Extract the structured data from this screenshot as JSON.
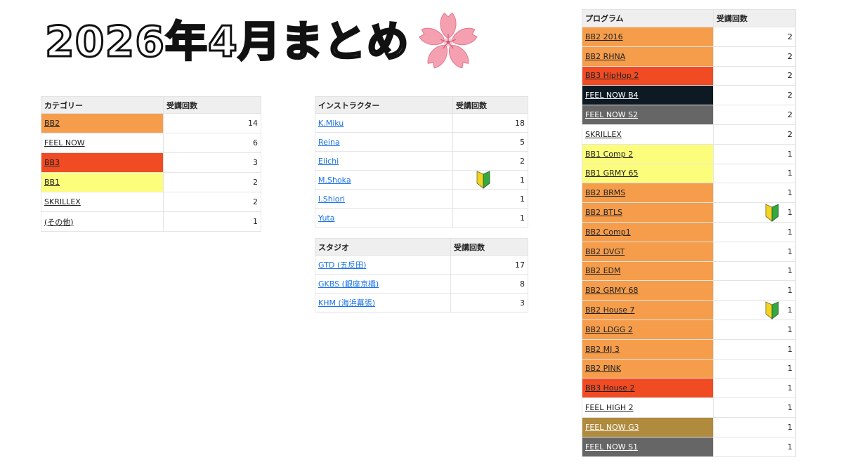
{
  "title": "2026年4月まとめ",
  "colors": {
    "orange": "#f59d4b",
    "red": "#f04b22",
    "yellow": "#fdfd7c",
    "black": "#0d1a23",
    "gray": "#666666",
    "gold": "#b08a3d",
    "white": "#ffffff"
  },
  "category_table": {
    "headers": [
      "カテゴリー",
      "受講回数"
    ],
    "rows": [
      {
        "name": "BB2",
        "count": "14",
        "bg": "orange"
      },
      {
        "name": "FEEL NOW",
        "count": "6",
        "bg": "white"
      },
      {
        "name": "BB3",
        "count": "3",
        "bg": "red"
      },
      {
        "name": "BB1",
        "count": "2",
        "bg": "yellow"
      },
      {
        "name": "SKRILLEX",
        "count": "2",
        "bg": "white"
      },
      {
        "name": "(その他)",
        "count": "1",
        "bg": "white"
      }
    ]
  },
  "instructor_table": {
    "headers": [
      "インストラクター",
      "受講回数"
    ],
    "rows": [
      {
        "name": "K.Miku",
        "count": "18"
      },
      {
        "name": "Reina",
        "count": "5"
      },
      {
        "name": "Eiichi",
        "count": "2"
      },
      {
        "name": "M.Shoka",
        "count": "1",
        "beginner": true
      },
      {
        "name": "I.Shiori",
        "count": "1"
      },
      {
        "name": "Yuta",
        "count": "1"
      }
    ]
  },
  "studio_table": {
    "headers": [
      "スタジオ",
      "受講回数"
    ],
    "rows": [
      {
        "name": "GTD (五反田)",
        "count": "17"
      },
      {
        "name": "GKBS (銀座京橋)",
        "count": "8"
      },
      {
        "name": "KHM (海浜幕張)",
        "count": "3"
      }
    ]
  },
  "program_table": {
    "headers": [
      "プログラム",
      "受講回数"
    ],
    "rows": [
      {
        "name": "BB2 2016",
        "count": "2",
        "bg": "orange"
      },
      {
        "name": "BB2 RHNA",
        "count": "2",
        "bg": "orange"
      },
      {
        "name": "BB3 HipHop 2",
        "count": "2",
        "bg": "red"
      },
      {
        "name": "FEEL NOW B4",
        "count": "2",
        "bg": "black"
      },
      {
        "name": "FEEL NOW S2",
        "count": "2",
        "bg": "gray"
      },
      {
        "name": "SKRILLEX",
        "count": "2",
        "bg": "white"
      },
      {
        "name": "BB1 Comp 2",
        "count": "1",
        "bg": "yellow"
      },
      {
        "name": "BB1 GRMY 65",
        "count": "1",
        "bg": "yellow"
      },
      {
        "name": "BB2 BRMS",
        "count": "1",
        "bg": "orange"
      },
      {
        "name": "BB2 BTLS",
        "count": "1",
        "bg": "orange",
        "beginner": true
      },
      {
        "name": "BB2 Comp1",
        "count": "1",
        "bg": "orange"
      },
      {
        "name": "BB2 DVGT",
        "count": "1",
        "bg": "orange"
      },
      {
        "name": "BB2 EDM",
        "count": "1",
        "bg": "orange"
      },
      {
        "name": "BB2 GRMY 68",
        "count": "1",
        "bg": "orange"
      },
      {
        "name": "BB2 House 7",
        "count": "1",
        "bg": "orange",
        "beginner": true
      },
      {
        "name": "BB2 LDGG 2",
        "count": "1",
        "bg": "orange"
      },
      {
        "name": "BB2 MJ 3",
        "count": "1",
        "bg": "orange"
      },
      {
        "name": "BB2 PINK",
        "count": "1",
        "bg": "orange"
      },
      {
        "name": "BB3 House 2",
        "count": "1",
        "bg": "red"
      },
      {
        "name": "FEEL HIGH 2",
        "count": "1",
        "bg": "white"
      },
      {
        "name": "FEEL NOW G3",
        "count": "1",
        "bg": "gold"
      },
      {
        "name": "FEEL NOW S1",
        "count": "1",
        "bg": "gray"
      }
    ]
  },
  "icons": {
    "title_icon": "sakura-icon",
    "badge_icon": "beginner-mark-icon"
  }
}
